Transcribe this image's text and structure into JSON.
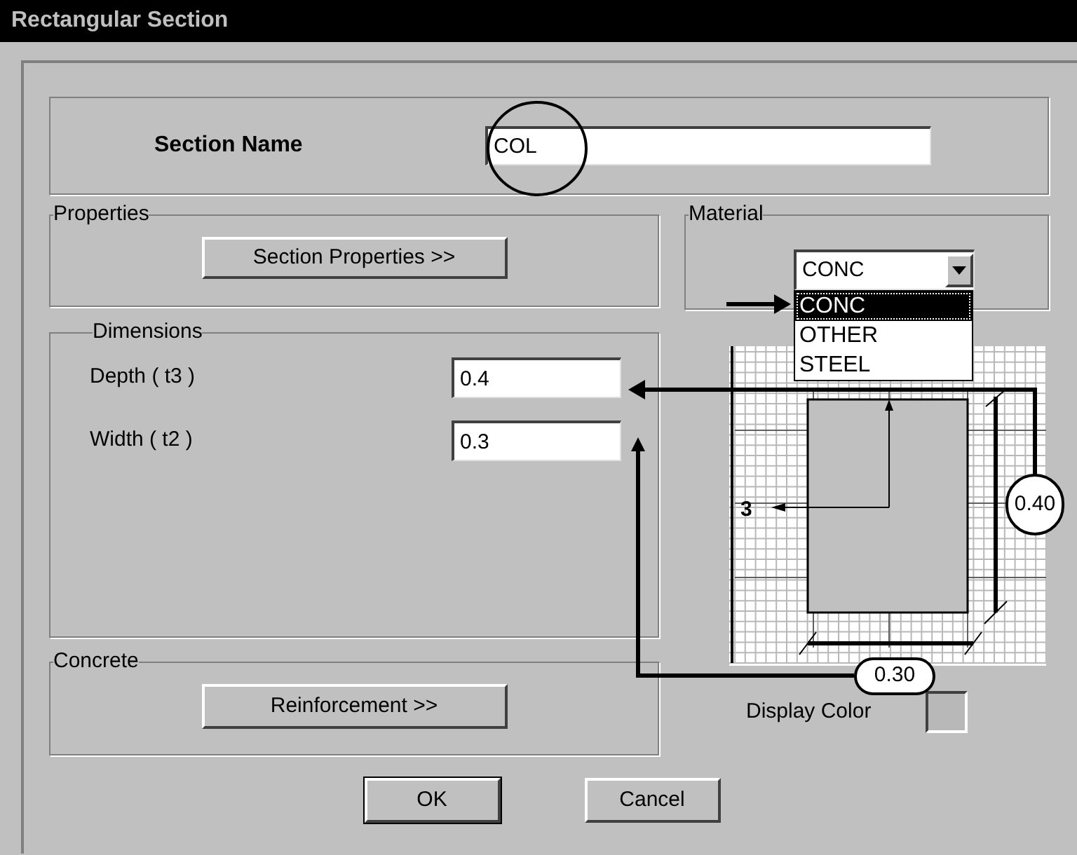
{
  "window": {
    "title": "Rectangular Section"
  },
  "section_name": {
    "label": "Section Name",
    "value": "COL"
  },
  "properties": {
    "legend": "Properties",
    "button": "Section Properties >>"
  },
  "material": {
    "legend": "Material",
    "value": "CONC",
    "expanded": true,
    "options": [
      {
        "label": "CONC",
        "selected": true
      },
      {
        "label": "OTHER",
        "selected": false
      },
      {
        "label": "STEEL",
        "selected": false
      }
    ]
  },
  "dimensions": {
    "legend": "Dimensions",
    "fields": [
      {
        "label": "Depth ( t3 )",
        "value": "0.4"
      },
      {
        "label": "Width ( t2 )",
        "value": "0.3"
      }
    ]
  },
  "concrete": {
    "legend": "Concrete",
    "button": "Reinforcement >>"
  },
  "diagram": {
    "axis_label": "3"
  },
  "annotations": {
    "depth_callout": "0.40",
    "width_callout": "0.30"
  },
  "display_color": {
    "label": "Display Color"
  },
  "buttons": [
    {
      "label": "OK",
      "default": true
    },
    {
      "label": "Cancel",
      "default": false
    }
  ]
}
